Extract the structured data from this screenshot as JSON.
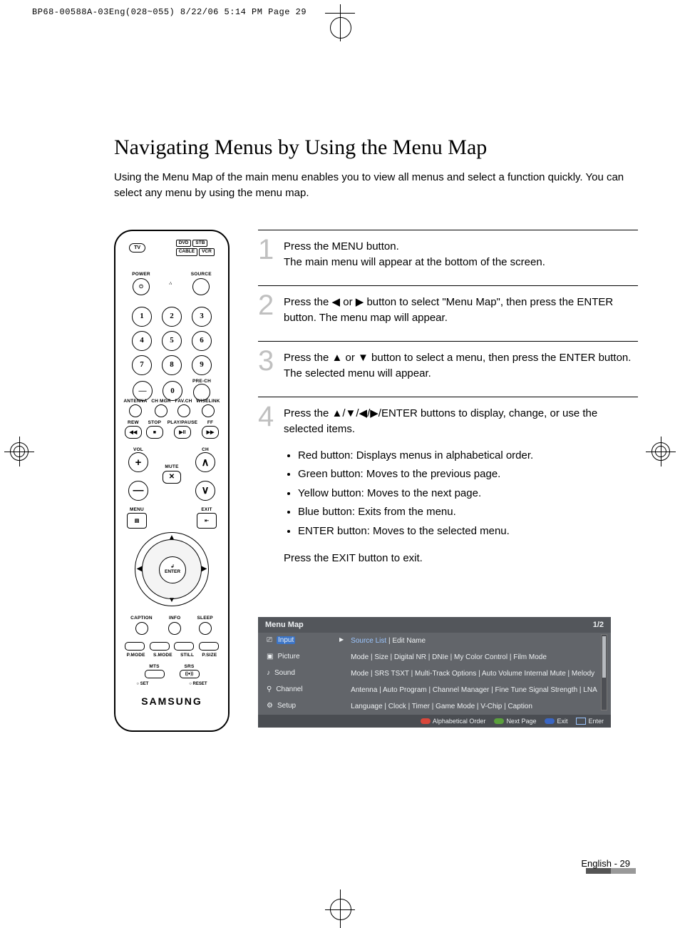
{
  "print_header": "BP68-00588A-03Eng(028~055)  8/22/06  5:14 PM  Page 29",
  "title": "Navigating Menus by Using the Menu Map",
  "intro": "Using the Menu Map of the main menu enables you to view all menus and select a function quickly. You can select any menu by using the menu map.",
  "remote": {
    "tv": "TV",
    "chips": [
      "DVD",
      "STB",
      "CABLE",
      "VCR"
    ],
    "power": "POWER",
    "source": "SOURCE",
    "nums_row1": [
      "1",
      "2",
      "3"
    ],
    "nums_row2": [
      "4",
      "5",
      "6"
    ],
    "nums_row3": [
      "7",
      "8",
      "9"
    ],
    "nums_row4_labels": [
      "",
      "0",
      "PRE-CH"
    ],
    "tiny_labels": [
      "ANTENNA",
      "CH MGR",
      "FAV.CH",
      "WISELINK"
    ],
    "play_labels": [
      "REW",
      "STOP",
      "PLAY/PAUSE",
      "FF"
    ],
    "play_icons": [
      "◀◀",
      "■",
      "▶II",
      "▶▶"
    ],
    "vol": "VOL",
    "ch": "CH",
    "mute": "MUTE",
    "mute_icon": "✕",
    "menu": "MENU",
    "exit": "EXIT",
    "enter_icon": "↲",
    "enter": "ENTER",
    "cap_row": [
      "CAPTION",
      "INFO",
      "SLEEP"
    ],
    "color_sub": [
      "P.MODE",
      "S.MODE",
      "STILL",
      "P.SIZE"
    ],
    "srs_row": [
      "MTS",
      "SRS"
    ],
    "srs_icon": "((●))",
    "set_reset": [
      "○ SET",
      "○ RESET"
    ],
    "brand": "SAMSUNG"
  },
  "steps": [
    {
      "num": "1",
      "text_a": "Press the MENU button.",
      "text_b": "The main menu will appear at the bottom of the screen."
    },
    {
      "num": "2",
      "text": "Press the ◀ or ▶ button to select \"Menu Map\", then press the ENTER button. The menu map will appear."
    },
    {
      "num": "3",
      "text": "Press the ▲ or ▼ button to select a menu, then press the ENTER button. The selected menu will appear."
    },
    {
      "num": "4",
      "text": "Press the ▲/▼/◀/▶/ENTER buttons to display, change, or use the selected items.",
      "bullets": [
        "Red button: Displays menus in alphabetical order.",
        "Green button: Moves to the previous page.",
        "Yellow button: Moves to the next page.",
        "Blue button: Exits from the menu.",
        "ENTER button: Moves to the selected menu."
      ],
      "text_after": "Press the EXIT button to exit."
    }
  ],
  "osd": {
    "title": "Menu Map",
    "page": "1/2",
    "rows": [
      {
        "cat": "Input",
        "sel": true,
        "desc_hl": "Source List",
        "desc_rest": " | Edit Name"
      },
      {
        "cat": "Picture",
        "desc": "Mode | Size | Digital NR | DNIe | My Color Control | Film Mode"
      },
      {
        "cat": "Sound",
        "desc": "Mode | SRS TSXT | Multi-Track Options | Auto Volume Internal Mute | Melody"
      },
      {
        "cat": "Channel",
        "desc": "Antenna | Auto Program | Channel Manager | Fine Tune Signal Strength | LNA"
      },
      {
        "cat": "Setup",
        "desc": "Language | Clock | Timer | Game Mode | V-Chip | Caption"
      }
    ],
    "footer": {
      "alpha": "Alphabetical Order",
      "next": "Next Page",
      "exit": "Exit",
      "enter": "Enter"
    }
  },
  "page_footer": "English - 29"
}
